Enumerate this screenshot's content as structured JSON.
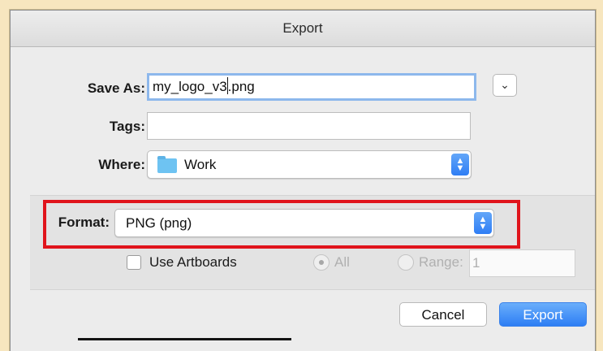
{
  "dialog": {
    "title": "Export",
    "save_as": {
      "label": "Save As:",
      "value_before_caret": "my_logo_v3",
      "value_after_caret": ".png"
    },
    "tags": {
      "label": "Tags:",
      "value": ""
    },
    "where": {
      "label": "Where:",
      "folder": "Work",
      "folder_icon": "folder-icon"
    },
    "format": {
      "label": "Format:",
      "value": "PNG (png)",
      "highlight_color": "#e0141c"
    },
    "use_artboards": {
      "label": "Use Artboards",
      "checked": false
    },
    "all_radio": {
      "label": "All",
      "selected": true
    },
    "range_radio": {
      "label": "Range:",
      "value": "1"
    },
    "buttons": {
      "cancel": "Cancel",
      "export": "Export"
    },
    "colors": {
      "accent": "#2f7ef5",
      "window_bg": "#ececec",
      "page_bg": "#f7e6bf"
    }
  }
}
